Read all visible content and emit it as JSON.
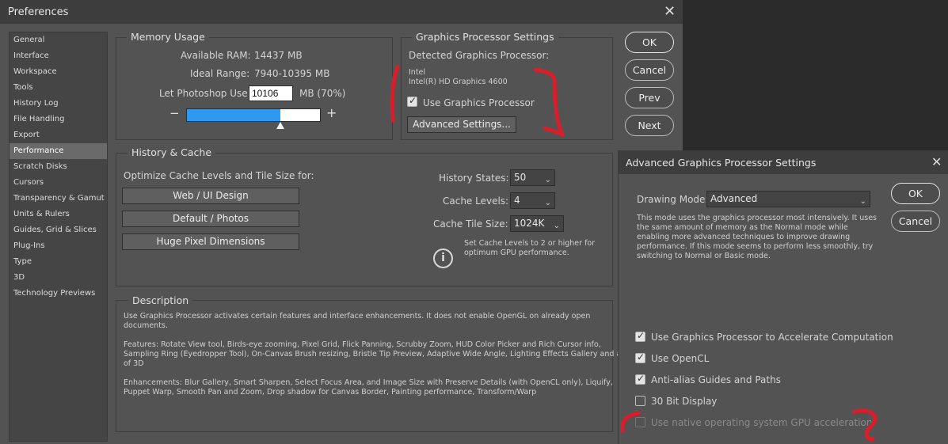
{
  "window": {
    "title": "Preferences"
  },
  "sidebar": {
    "items": [
      {
        "label": "General"
      },
      {
        "label": "Interface"
      },
      {
        "label": "Workspace"
      },
      {
        "label": "Tools"
      },
      {
        "label": "History Log"
      },
      {
        "label": "File Handling"
      },
      {
        "label": "Export"
      },
      {
        "label": "Performance",
        "selected": true
      },
      {
        "label": "Scratch Disks"
      },
      {
        "label": "Cursors"
      },
      {
        "label": "Transparency & Gamut"
      },
      {
        "label": "Units & Rulers"
      },
      {
        "label": "Guides, Grid & Slices"
      },
      {
        "label": "Plug-Ins"
      },
      {
        "label": "Type"
      },
      {
        "label": "3D"
      },
      {
        "label": "Technology Previews"
      }
    ]
  },
  "memory": {
    "title": "Memory Usage",
    "available_label": "Available RAM:",
    "available_value": "14437 MB",
    "ideal_label": "Ideal Range:",
    "ideal_value": "7940-10395 MB",
    "let_label": "Let Photoshop Use:",
    "let_value": "10106",
    "let_unit": "MB (70%)",
    "minus": "−",
    "plus": "+",
    "slider_fraction": 0.7
  },
  "gpu": {
    "title": "Graphics Processor Settings",
    "detected_label": "Detected Graphics Processor:",
    "vendor": "Intel",
    "model": "Intel(R) HD Graphics 4600",
    "use_label": "Use Graphics Processor",
    "use_checked": true,
    "advanced_button": "Advanced Settings..."
  },
  "buttons": {
    "ok": "OK",
    "cancel": "Cancel",
    "prev": "Prev",
    "next": "Next"
  },
  "history": {
    "title": "History & Cache",
    "optimize_label": "Optimize Cache Levels and Tile Size for:",
    "preset_buttons": [
      "Web / UI Design",
      "Default / Photos",
      "Huge Pixel Dimensions"
    ],
    "states_label": "History States:",
    "states_value": "50",
    "levels_label": "Cache Levels:",
    "levels_value": "4",
    "tile_label": "Cache Tile Size:",
    "tile_value": "1024K",
    "info_icon": "i",
    "info_text_1": "Set Cache Levels to 2 or higher for",
    "info_text_2": "optimum GPU performance."
  },
  "description": {
    "title": "Description",
    "lines": [
      "Use Graphics Processor activates certain features and interface enhancements. It does not enable OpenGL on already open",
      "documents.",
      "",
      "Features: Rotate View tool, Birds-eye zooming, Pixel Grid, Flick Panning, Scrubby Zoom, HUD Color Picker and Rich Cursor info,",
      "Sampling Ring (Eyedropper Tool), On-Canvas Brush resizing, Bristle Tip Preview, Adaptive Wide Angle, Lighting Effects Gallery and all",
      "of 3D",
      "",
      "Enhancements: Blur Gallery, Smart Sharpen, Select Focus Area, and Image Size with Preserve Details (with OpenCL only), Liquify,",
      "Puppet Warp, Smooth Pan and Zoom, Drop shadow for Canvas Border, Painting performance, Transform/Warp"
    ]
  },
  "advanced": {
    "title": "Advanced Graphics Processor Settings",
    "drawing_mode_label": "Drawing Mode:",
    "drawing_mode_value": "Advanced",
    "mode_desc": [
      "This mode uses the graphics processor most intensively.  It uses",
      "the same amount of memory as the Normal mode while",
      "enabling more advanced techniques to improve drawing",
      "performance.  If this mode seems to perform less smoothly, try",
      "switching to Normal or Basic mode."
    ],
    "ok": "OK",
    "cancel": "Cancel",
    "options": [
      {
        "label": "Use Graphics Processor to Accelerate Computation",
        "state": "checked"
      },
      {
        "label": "Use OpenCL",
        "state": "checked"
      },
      {
        "label": "Anti-alias Guides and Paths",
        "state": "checked"
      },
      {
        "label": "30 Bit Display",
        "state": "unchecked"
      },
      {
        "label": "Use native operating system GPU acceleration",
        "state": "disabled"
      }
    ]
  },
  "icons": {
    "close": "✕",
    "chevron": "⌄",
    "check": "✓"
  },
  "colors": {
    "slider_fill": "#2e9aef",
    "annotation": "#d81e2a"
  }
}
